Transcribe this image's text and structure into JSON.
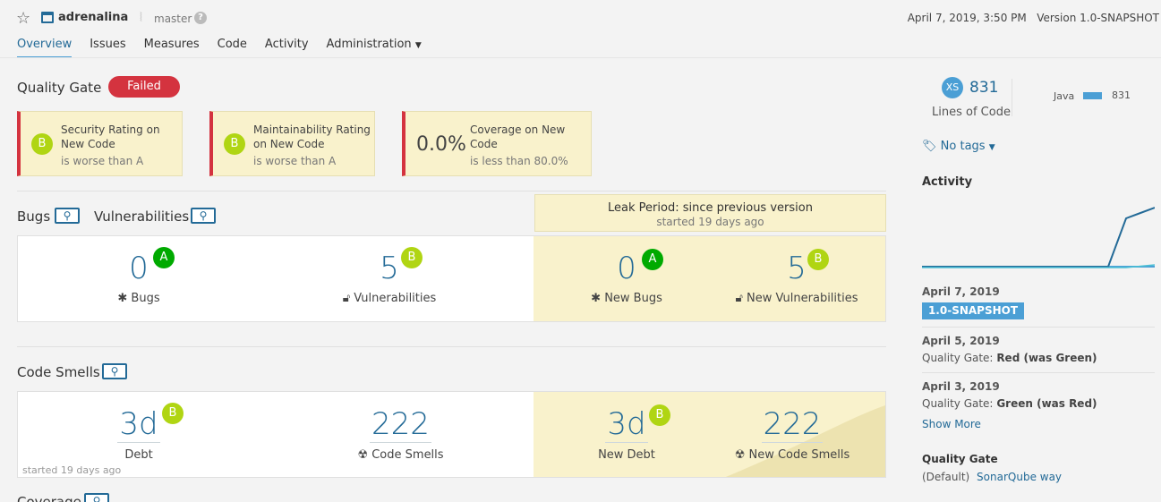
{
  "header": {
    "project_name": "adrenalina",
    "branch": "master",
    "help_glyph": "?",
    "date": "April 7, 2019, 3:50 PM",
    "version": "Version 1.0-SNAPSHOT"
  },
  "nav": {
    "tabs": [
      "Overview",
      "Issues",
      "Measures",
      "Code",
      "Activity",
      "Administration"
    ],
    "active": "Overview"
  },
  "quality_gate": {
    "title": "Quality Gate",
    "status": "Failed",
    "conditions": [
      {
        "rating": "B",
        "metric": "Security Rating on New Code",
        "detail": "is worse than A"
      },
      {
        "rating": "B",
        "metric": "Maintainability Rating on New Code",
        "detail": "is worse than A"
      },
      {
        "value": "0.0%",
        "metric": "Coverage on New Code",
        "detail": "is less than 80.0%"
      }
    ]
  },
  "leak_period": {
    "title": "Leak Period: since previous version",
    "started": "started 19 days ago"
  },
  "bugs_vulns": {
    "bugs_title": "Bugs",
    "vulns_title": "Vulnerabilities",
    "bugs": {
      "value": "0",
      "rating": "A",
      "label": "Bugs"
    },
    "vulnerabilities": {
      "value": "5",
      "rating": "B",
      "label": "Vulnerabilities"
    },
    "new_bugs": {
      "value": "0",
      "rating": "A",
      "label": "New Bugs"
    },
    "new_vulnerabilities": {
      "value": "5",
      "rating": "B",
      "label": "New Vulnerabilities"
    }
  },
  "code_smells": {
    "title": "Code Smells",
    "debt": {
      "value": "3d",
      "rating": "B",
      "label": "Debt"
    },
    "smells": {
      "value": "222",
      "label": "Code Smells"
    },
    "new_debt": {
      "value": "3d",
      "rating": "B",
      "label": "New Debt"
    },
    "new_smells": {
      "value": "222",
      "label": "New Code Smells"
    },
    "started_note": "started 19 days ago"
  },
  "coverage": {
    "title": "Coverage"
  },
  "sidebar": {
    "size_badge": "XS",
    "lines_of_code": "831",
    "lines_label": "Lines of Code",
    "language": "Java",
    "language_lines": "831",
    "tags": "No tags",
    "activity_title": "Activity",
    "events": [
      {
        "date": "April 7, 2019",
        "version": "1.0-SNAPSHOT"
      },
      {
        "date": "April 5, 2019",
        "qg_label": "Quality Gate:",
        "qg_value": "Red (was Green)"
      },
      {
        "date": "April 3, 2019",
        "qg_label": "Quality Gate:",
        "qg_value": "Green (was Red)"
      }
    ],
    "show_more": "Show More",
    "qg_section_title": "Quality Gate",
    "qg_default": "(Default)",
    "qg_name": "SonarQube way"
  },
  "colors": {
    "failed": "#d4333f",
    "rating_A": "#00aa00",
    "rating_B": "#b0d513",
    "link": "#236a97",
    "leak_bg": "#f9f2cc"
  }
}
